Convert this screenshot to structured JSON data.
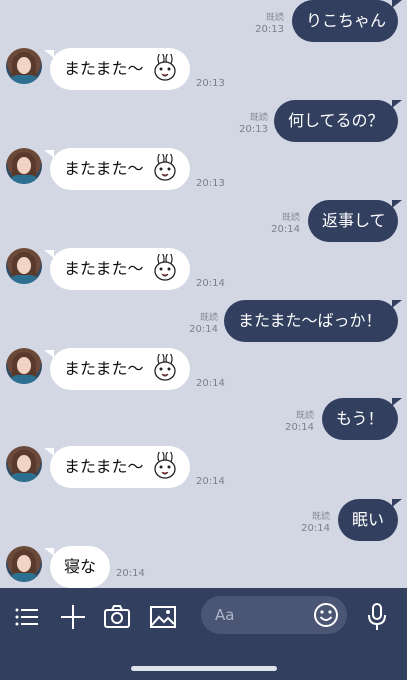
{
  "chat": {
    "read_label": "既読",
    "messages": [
      {
        "side": "out",
        "text": "りこちゃん",
        "time": "20:13",
        "read": true
      },
      {
        "side": "in",
        "text": "またまた〜",
        "sticker": "bunny-face-icon",
        "time": "20:13"
      },
      {
        "side": "out",
        "text": "何してるの？",
        "time": "20:13",
        "read": true
      },
      {
        "side": "in",
        "text": "またまた〜",
        "sticker": "bunny-face-icon",
        "time": "20:13"
      },
      {
        "side": "out",
        "text": "返事して",
        "time": "20:14",
        "read": true
      },
      {
        "side": "in",
        "text": "またまた〜",
        "sticker": "bunny-face-icon",
        "time": "20:14"
      },
      {
        "side": "out",
        "text": "またまた〜ばっか！",
        "time": "20:14",
        "read": true
      },
      {
        "side": "in",
        "text": "またまた〜",
        "sticker": "bunny-face-icon",
        "time": "20:14"
      },
      {
        "side": "out",
        "text": "もう！",
        "time": "20:14",
        "read": true
      },
      {
        "side": "in",
        "text": "またまた〜",
        "sticker": "bunny-face-icon",
        "time": "20:14"
      },
      {
        "side": "out",
        "text": "眠い",
        "time": "20:14",
        "read": true
      },
      {
        "side": "in",
        "text": "寝な",
        "time": "20:14"
      }
    ]
  },
  "composer": {
    "placeholder": "Aa",
    "icons": [
      "menu-icon",
      "plus-icon",
      "camera-icon",
      "image-icon",
      "emoji-icon",
      "microphone-icon"
    ]
  },
  "colors": {
    "background": "#d3d7e3",
    "outgoing_bubble": "#323f5f",
    "incoming_bubble": "#ffffff",
    "composer_bar": "#323f5f"
  }
}
